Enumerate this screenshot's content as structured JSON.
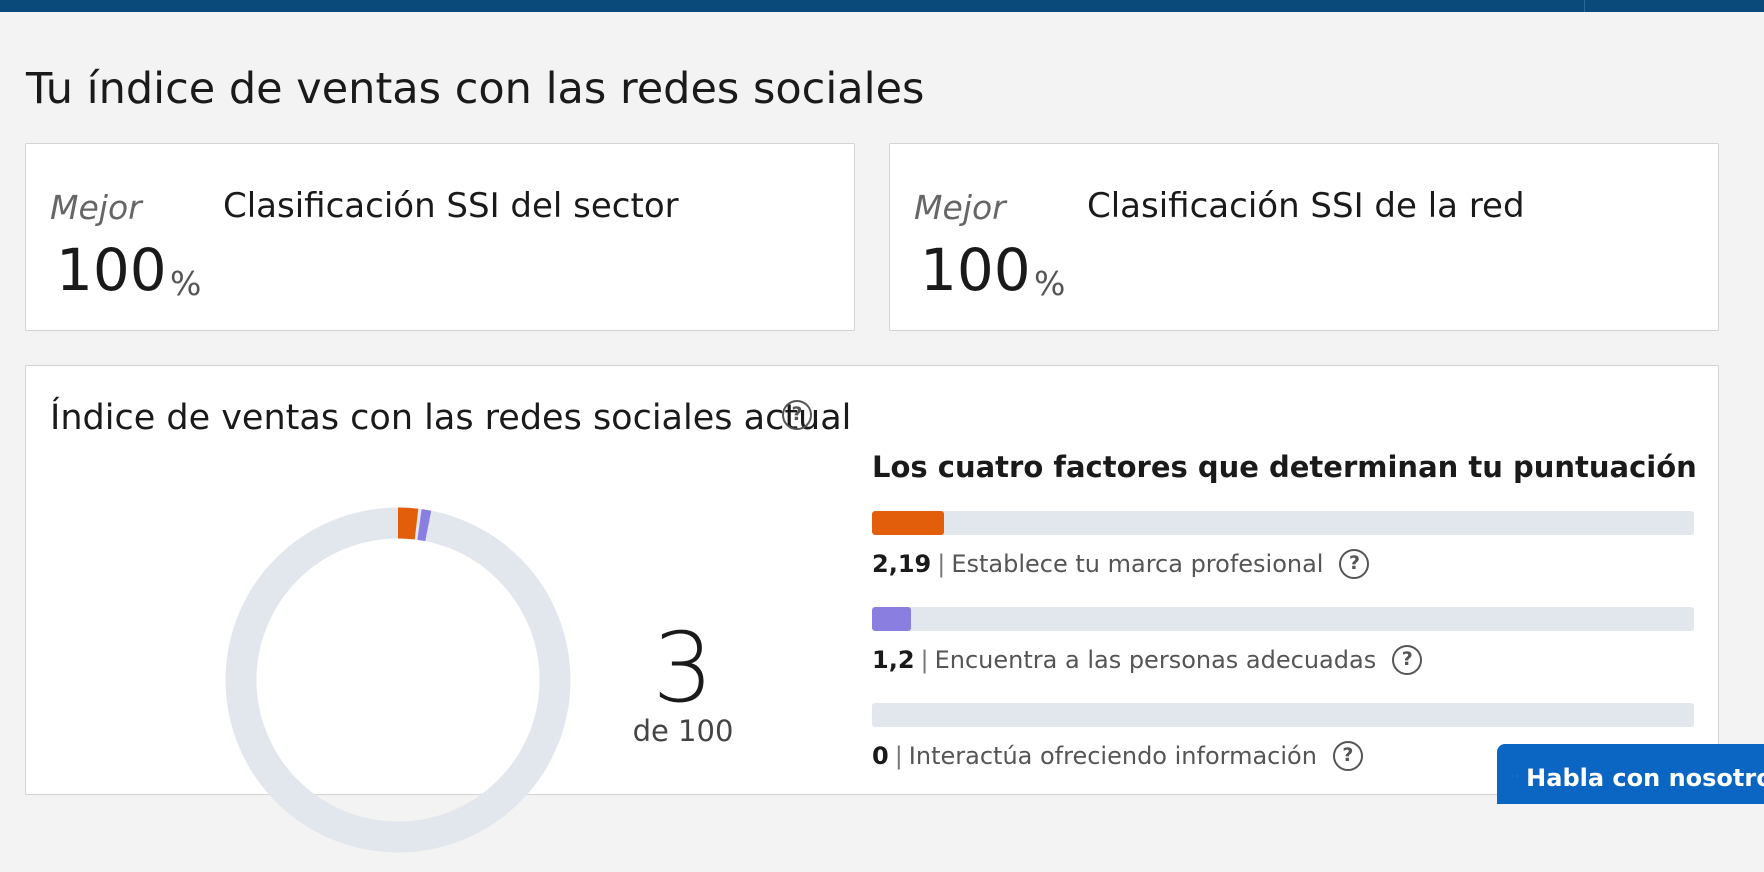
{
  "page": {
    "title": "Tu índice de ventas con las redes sociales"
  },
  "rank_cards": [
    {
      "label": "Mejor",
      "title": "Clasificación SSI del sector",
      "value": "100",
      "unit": "%"
    },
    {
      "label": "Mejor",
      "title": "Clasificación SSI de la red",
      "value": "100",
      "unit": "%"
    }
  ],
  "ssi": {
    "title": "Índice de ventas con las redes sociales actual",
    "score": "3",
    "score_of": "de 100",
    "factors_title": "Los cuatro factores que determinan tu puntuación",
    "factors": [
      {
        "value": "2,19",
        "label": "Establece tu marca profesional",
        "color": "#e35e0b",
        "max": 25,
        "numeric": 2.19
      },
      {
        "value": "1,2",
        "label": "Encuentra a las personas adecuadas",
        "color": "#8a7ee0",
        "max": 25,
        "numeric": 1.2
      },
      {
        "value": "0",
        "label": "Interactúa ofreciendo información",
        "color": "#3aa3c2",
        "max": 25,
        "numeric": 0
      }
    ],
    "help_glyph": "?"
  },
  "chat": {
    "label": "Habla con nosotros"
  },
  "colors": {
    "topbar": "#0a4a7a",
    "track": "#e2e7ed",
    "chat_button": "#0a66c2"
  }
}
